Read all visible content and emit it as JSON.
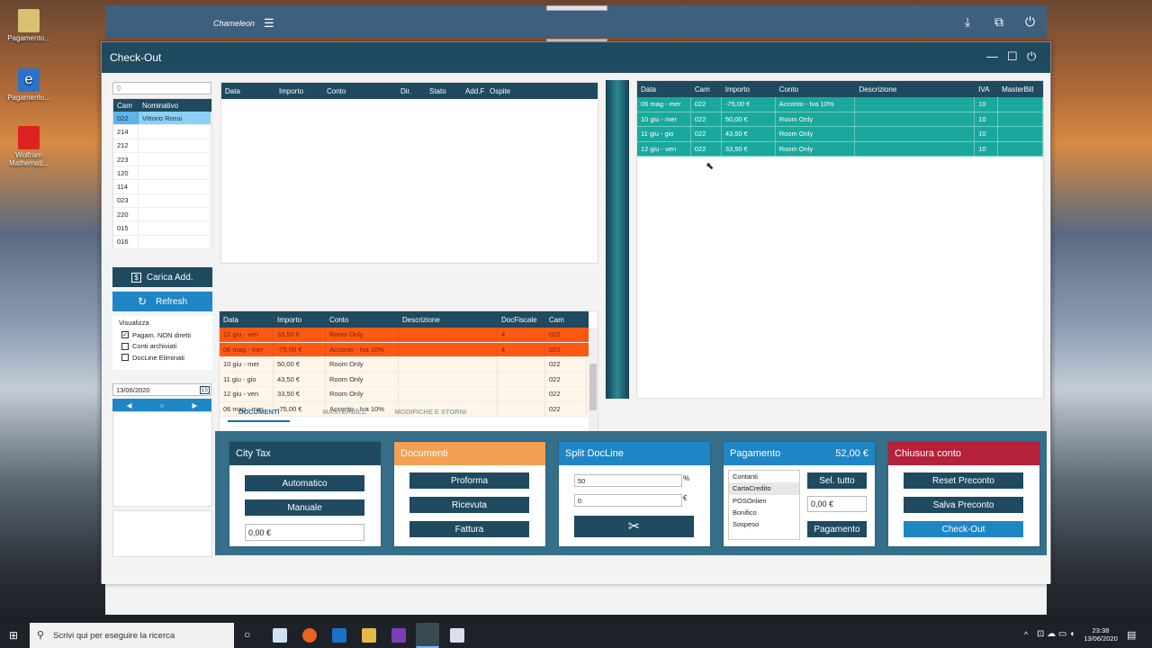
{
  "desktop": {
    "icons": [
      {
        "label": "Pagamento...",
        "color": "#d8c070"
      },
      {
        "label": "Pagamento...",
        "color": "#2b73c8"
      },
      {
        "label": "Wolfram Mathemati...",
        "color": "#d22"
      }
    ]
  },
  "bg_window": {
    "title": "Chameleon"
  },
  "window": {
    "title": "Check-Out"
  },
  "rooms": {
    "headers": [
      "Cam",
      "Nominativo"
    ],
    "rows": [
      [
        "022",
        "Vittorio Rossi"
      ],
      [
        "214",
        ""
      ],
      [
        "212",
        ""
      ],
      [
        "223",
        ""
      ],
      [
        "120",
        ""
      ],
      [
        "114",
        ""
      ],
      [
        "023",
        ""
      ],
      [
        "220",
        ""
      ],
      [
        "015",
        ""
      ],
      [
        "016",
        ""
      ]
    ]
  },
  "actions": {
    "carica": "Carica Add.",
    "refresh": "Refresh"
  },
  "visualizza": {
    "title": "Visualizza",
    "options": [
      {
        "label": "Pagam. NON diretti",
        "checked": "✓"
      },
      {
        "label": "Conti archiviati",
        "checked": ""
      },
      {
        "label": "DocLine Eliminati",
        "checked": ""
      }
    ]
  },
  "date": {
    "value": "13/06/2020",
    "cal": "15",
    "prev": "◀",
    "today": "○",
    "next": "▶"
  },
  "addebiti": {
    "headers": [
      "Data",
      "Importo",
      "Conto",
      "Dir.",
      "Stato",
      "Add.F",
      "Ospite"
    ]
  },
  "pagamenti": {
    "headers": [
      "Data",
      "Importo",
      "Conto",
      "Descrizione",
      "DocFiscale",
      "Cam"
    ],
    "rows": [
      [
        "12 giu - ven",
        "33,50 €",
        "Room Only",
        "",
        "4",
        "022"
      ],
      [
        "06 mag - mer",
        "-75,00 €",
        "Acconto - Iva 10%",
        "",
        "4",
        "022"
      ],
      [
        "10 giu - mer",
        "50,00 €",
        "Room Only",
        "",
        "",
        "022"
      ],
      [
        "11 giu - gio",
        "43,50 €",
        "Room Only",
        "",
        "",
        "022"
      ],
      [
        "12 giu - ven",
        "33,50 €",
        "Room Only",
        "",
        "",
        "022"
      ],
      [
        "06 mag - mer",
        "-75,00 €",
        "Acconto - Iva 10%",
        "",
        "",
        "022"
      ]
    ]
  },
  "conto": {
    "headers": [
      "Data",
      "Cam",
      "Importo",
      "Conto",
      "Descrizione",
      "IVA",
      "MasterBill"
    ],
    "rows": [
      [
        "06 mag - mer",
        "022",
        "-75,00 €",
        "Acconto - Iva 10%",
        "",
        "10",
        ""
      ],
      [
        "10 giu - mer",
        "022",
        "50,00 €",
        "Room Only",
        "",
        "10",
        ""
      ],
      [
        "11 giu - gio",
        "022",
        "43,50 €",
        "Room Only",
        "",
        "10",
        ""
      ],
      [
        "12 giu - ven",
        "022",
        "33,50 €",
        "Room Only",
        "",
        "10",
        ""
      ]
    ]
  },
  "tabs": [
    "DOCUMENTI",
    "MASTERBILL",
    "MODIFICHE E STORNI"
  ],
  "citytax": {
    "title": "City Tax",
    "automatico": "Automatico",
    "manuale": "Manuale",
    "value": "0,00 €"
  },
  "documenti": {
    "title": "Documenti",
    "proforma": "Proforma",
    "ricevuta": "Ricevuta",
    "fattura": "Fattura"
  },
  "split": {
    "title": "Split DocLine",
    "percent": "50",
    "percent_unit": "%",
    "amount": "0",
    "amount_unit": "€"
  },
  "pagamento": {
    "title": "Pagamento",
    "total": "52,00 €",
    "methods": [
      "Contanti",
      "CartaCredito",
      "POSOnlien",
      "Bonifico",
      "Sospeso"
    ],
    "sel_tutto": "Sel. tutto",
    "value": "0,00 €",
    "button": "Pagamento"
  },
  "chiusura": {
    "title": "Chiusura conto",
    "reset": "Reset Preconto",
    "salva": "Salva Preconto",
    "checkout": "Check-Out"
  },
  "taskbar": {
    "search_placeholder": "Scrivi qui per eseguire la ricerca",
    "time": "23:38",
    "date": "13/06/2020"
  },
  "colors": {
    "dark": "#1f4a5f",
    "teal": "#1aa89c",
    "orange_red": "#ff5a14",
    "accent_blue": "#1f86c6",
    "orange": "#f2a052",
    "crimson": "#b5213a"
  }
}
